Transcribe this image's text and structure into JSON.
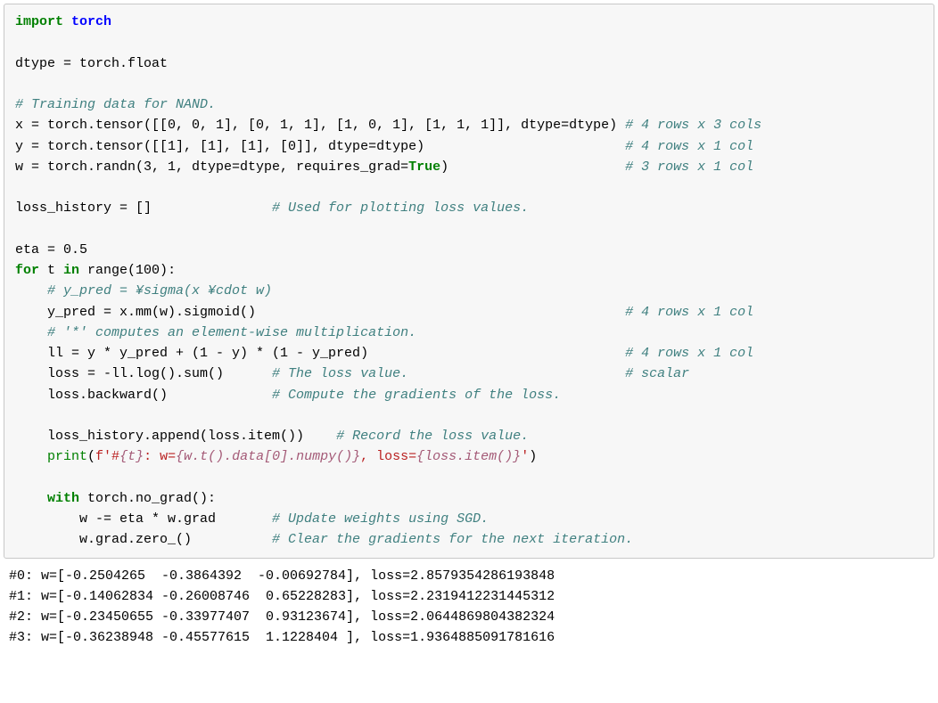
{
  "code": {
    "l01_kw_import": "import",
    "l01_mod": "torch",
    "l03_stmt": "dtype = torch.float",
    "l05_cmt": "# Training data for NAND.",
    "l06_a": "x = torch.tensor([[0, 0, 1], [0, 1, 1], [1, 0, 1], [1, 1, 1]], dtype=dtype) ",
    "l06_cmt": "# 4 rows x 3 cols",
    "l07_a": "y = torch.tensor([[1], [1], [1], [0]], dtype=dtype)                         ",
    "l07_cmt": "# 4 rows x 1 col",
    "l08_a": "w = torch.randn(3, 1, dtype=dtype, requires_grad=",
    "l08_true": "True",
    "l08_b": ")                      ",
    "l08_cmt": "# 3 rows x 1 col",
    "l10_a": "loss_history = []               ",
    "l10_cmt": "# Used for plotting loss values.",
    "l12_stmt": "eta = 0.5",
    "l13_for": "for",
    "l13_t": " t ",
    "l13_in": "in",
    "l13_rest": " range(100):",
    "l14_cmt": "    # y_pred = ¥sigma(x ¥cdot w)",
    "l15_a": "    y_pred = x.mm(w).sigmoid()                                              ",
    "l15_cmt": "# 4 rows x 1 col",
    "l16_cmt": "    # '*' computes an element-wise multiplication.",
    "l17_a": "    ll = y * y_pred + (1 - y) * (1 - y_pred)                                ",
    "l17_cmt": "# 4 rows x 1 col",
    "l18_a": "    loss = -ll.log().sum()      ",
    "l18_cmt": "# The loss value.",
    "l18_pad": "                           ",
    "l18_cmt2": "# scalar",
    "l19_a": "    loss.backward()             ",
    "l19_cmt": "# Compute the gradients of the loss.",
    "l21_a": "    loss_history.append(loss.item())    ",
    "l21_cmt": "# Record the loss value.",
    "l22_indent": "    ",
    "l22_print": "print",
    "l22_paren": "(",
    "l22_fa": "f'#",
    "l22_fexpr1": "{t}",
    "l22_fb": ": w=",
    "l22_fexpr2": "{w.t().data[0].numpy()}",
    "l22_fc": ", loss=",
    "l22_fexpr3": "{loss.item()}",
    "l22_fd": "'",
    "l22_close": ")",
    "l24_indent": "    ",
    "l24_with": "with",
    "l24_rest": " torch.no_grad():",
    "l25_a": "        w -= eta * w.grad       ",
    "l25_cmt": "# Update weights using SGD.",
    "l26_a": "        w.grad.zero_()          ",
    "l26_cmt": "# Clear the gradients for the next iteration."
  },
  "output": {
    "l0": "#0: w=[-0.2504265  -0.3864392  -0.00692784], loss=2.8579354286193848",
    "l1": "#1: w=[-0.14062834 -0.26008746  0.65228283], loss=2.2319412231445312",
    "l2": "#2: w=[-0.23450655 -0.33977407  0.93123674], loss=2.0644869804382324",
    "l3": "#3: w=[-0.36238948 -0.45577615  1.1228404 ], loss=1.9364885091781616"
  }
}
